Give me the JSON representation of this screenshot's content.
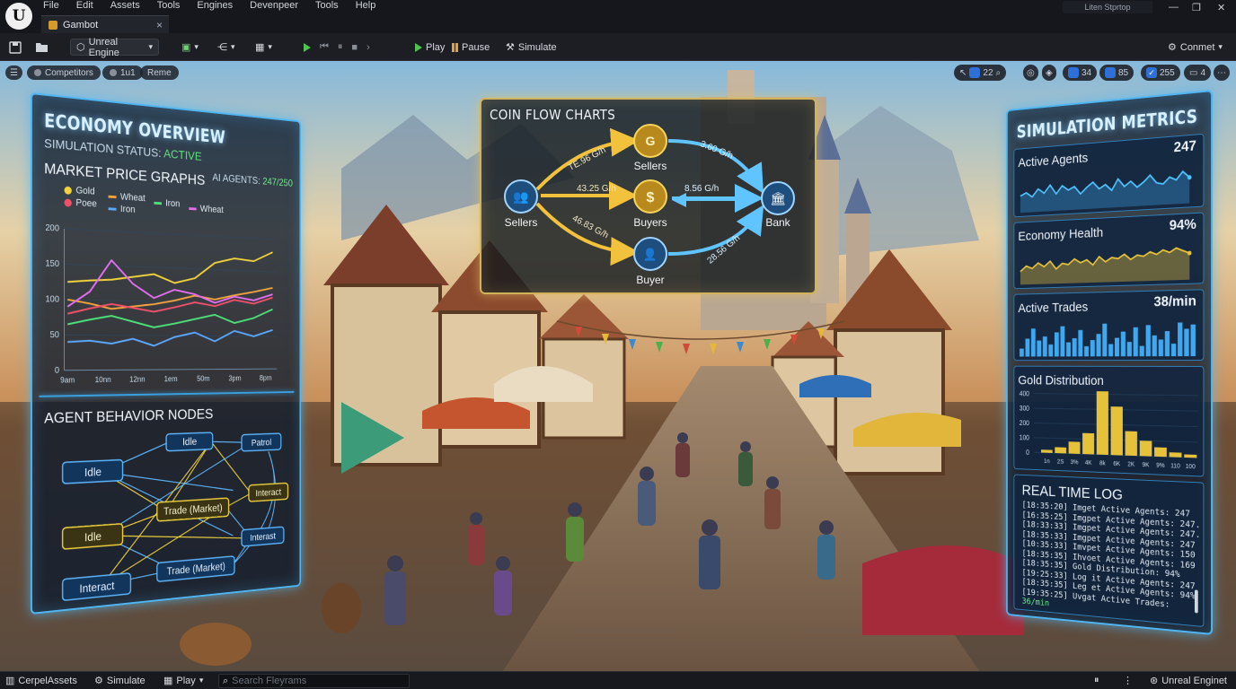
{
  "menubar": {
    "items": [
      "File",
      "Edit",
      "Assets",
      "Tools",
      "Engines",
      "Devenpeer",
      "Tools",
      "Help"
    ],
    "tab_title": "Gambot",
    "window_title": "Liten Stprtop"
  },
  "toolbar": {
    "engine_label": "Unreal Engine",
    "play_label": "Play",
    "pause_label": "Pause",
    "simulate_label": "Simulate",
    "settings_label": "Conmet"
  },
  "viewport": {
    "chips": [
      "Competitors",
      "1u1",
      "Reme"
    ],
    "right_values": [
      "22",
      "34",
      "85",
      "255",
      "4"
    ]
  },
  "economy": {
    "title": "ECONOMY OVERVIEW",
    "status_prefix": "SIMULATION STATUS:",
    "status_value": "ACTIVE",
    "agents_prefix": "AI AGENTS:",
    "agents_value": "247/250",
    "graph_title": "MARKET PRICE GRAPHS",
    "legend": [
      {
        "name": "Gold",
        "color": "#f2d33c"
      },
      {
        "name": "Wheat",
        "color": "#f2a33c"
      },
      {
        "name": "Iron",
        "color": "#4ee07a"
      },
      {
        "name": "Wheat",
        "color": "#e46ef0"
      },
      {
        "name": "Poee",
        "color": "#f0506a"
      },
      {
        "name": "Iron",
        "color": "#5aa9ff"
      }
    ],
    "nodes_title": "AGENT BEHAVIOR NODES",
    "nodes": [
      "Idle",
      "Idle",
      "Patrol",
      "Idle",
      "Trade (Market)",
      "Interact",
      "Interact",
      "Interast",
      "Trade (Market)"
    ]
  },
  "chart_data": [
    {
      "type": "line",
      "title": "MARKET PRICE GRAPHS",
      "x": [
        "9am",
        "10nn",
        "12nn",
        "1em",
        "50m",
        "3pm",
        "8pm"
      ],
      "ylim": [
        0,
        200
      ],
      "yticks": [
        0,
        50,
        100,
        150,
        200
      ],
      "series": [
        {
          "name": "Gold",
          "color": "#f2d33c",
          "values": [
            125,
            128,
            130,
            135,
            140,
            128,
            136,
            160,
            168,
            165,
            180
          ]
        },
        {
          "name": "Wheat",
          "color": "#f2a33c",
          "values": [
            100,
            95,
            88,
            92,
            96,
            102,
            110,
            105,
            112,
            118,
            125
          ]
        },
        {
          "name": "Iron",
          "color": "#4ee07a",
          "values": [
            65,
            72,
            78,
            70,
            62,
            68,
            75,
            82,
            70,
            78,
            92
          ]
        },
        {
          "name": "Wheat",
          "color": "#e46ef0",
          "values": [
            90,
            112,
            158,
            125,
            105,
            118,
            112,
            100,
            110,
            105,
            115
          ]
        },
        {
          "name": "Poee",
          "color": "#f0506a",
          "values": [
            80,
            88,
            95,
            90,
            85,
            92,
            100,
            95,
            105,
            100,
            110
          ]
        },
        {
          "name": "Iron",
          "color": "#5aa9ff",
          "values": [
            40,
            42,
            38,
            45,
            35,
            48,
            55,
            42,
            58,
            50,
            60
          ]
        }
      ]
    },
    {
      "type": "bar",
      "title": "Gold Distribution",
      "categories": [
        "1n",
        "2S",
        "3%",
        "4K",
        "8k",
        "6K",
        "2K",
        "9K",
        "9%",
        "110",
        "100"
      ],
      "values": [
        20,
        40,
        80,
        140,
        420,
        320,
        160,
        100,
        60,
        30,
        20
      ],
      "ylim": [
        0,
        400
      ],
      "yticks": [
        0,
        100,
        200,
        300,
        400
      ]
    },
    {
      "type": "bar",
      "title": "Active Trades",
      "values": [
        4,
        9,
        14,
        8,
        10,
        6,
        12,
        15,
        7,
        9,
        13,
        5,
        8,
        11,
        16,
        6,
        9,
        12,
        7,
        14,
        5,
        15,
        10,
        8,
        12,
        6,
        16,
        13,
        15
      ]
    },
    {
      "type": "area",
      "title": "Active Agents",
      "values": [
        22,
        26,
        20,
        30,
        24,
        34,
        22,
        32,
        26,
        30,
        20,
        28,
        34,
        25,
        30,
        22,
        36,
        26,
        32,
        24,
        30,
        38,
        28,
        26,
        34,
        30,
        40,
        32
      ]
    },
    {
      "type": "area",
      "title": "Economy Health",
      "values": [
        20,
        28,
        24,
        32,
        26,
        34,
        22,
        30,
        28,
        36,
        30,
        34,
        26,
        38,
        30,
        36,
        34,
        40,
        32,
        38,
        36,
        42,
        38,
        44,
        40,
        46,
        42,
        38
      ]
    }
  ],
  "coin_flow": {
    "title": "COIN FLOW CHARTS",
    "nodes": {
      "left": "Sellers",
      "top": "Sellers",
      "mid": "Buyers",
      "bottom": "Buyer",
      "right": "Bank"
    },
    "rates": {
      "left_top": "TE.96 G/h",
      "left_mid": "43.25 G/h",
      "left_bottom": "46.83 G/h",
      "top_right": "3.60 G/h",
      "mid_right": "8.56 G/h",
      "bottom_right": "28.56 G/h"
    }
  },
  "metrics": {
    "title": "SIMULATION METRICS",
    "active_agents_label": "Active Agents",
    "active_agents_value": "247",
    "economy_health_label": "Economy Health",
    "economy_health_value": "94%",
    "active_trades_label": "Active Trades",
    "active_trades_value": "38/min",
    "gold_dist_label": "Gold Distribution",
    "log_title": "REAL TIME LOG",
    "log": [
      "[18:35:20] Imget Active Agents: 247",
      "[16:35:25] Imgpet Active Agents: 247.",
      "[18:33:33] Imgpet Active Agents: 247.",
      "[18:35:33] Imgpet Active Agents: 247",
      "[10:35:33] Imvpet Active Agents: 150",
      "[18:35:35] Ihvoet Active Agents: 169",
      "[18:35:35] Gold Distribution: 94%",
      "[19:25:33] Log it Active Agents: 247",
      "[18:35:35] Leg et Active Agents: 94%"
    ],
    "log_last_prefix": "[19:35:25] Uvgat Active Trades:",
    "log_last_value": "36/min"
  },
  "statusbar": {
    "content_label": "CerpelAssets",
    "simulate_label": "Simulate",
    "play_label": "Play",
    "search_placeholder": "Search Fleyrams",
    "engine_label": "Unreal Enginet"
  }
}
